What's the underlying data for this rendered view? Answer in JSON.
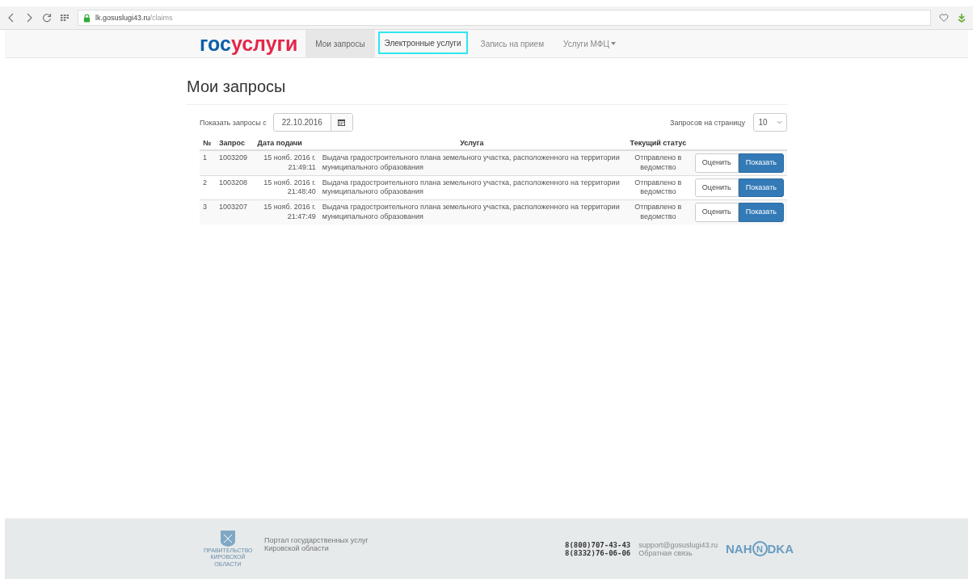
{
  "browser": {
    "url_host": "lk.gosuslugi43.ru",
    "url_path": "/claims"
  },
  "logo": {
    "part_1": "гос",
    "part_2": "услуги"
  },
  "nav": [
    {
      "label": "Мои запросы",
      "selected": true,
      "focused": false,
      "dropdown": false
    },
    {
      "label": "Электронные услуги",
      "selected": false,
      "focused": true,
      "dropdown": false
    },
    {
      "label": "Запись на прием",
      "selected": false,
      "focused": false,
      "dropdown": false
    },
    {
      "label": "Услуги МФЦ",
      "selected": false,
      "focused": false,
      "dropdown": true
    }
  ],
  "page_title": "Мои запросы",
  "filter": {
    "label": "Показать запросы с",
    "date": "22.10.2016",
    "per_page_label": "Запросов на страницу",
    "per_page": "10"
  },
  "table": {
    "columns": [
      "№",
      "Запрос",
      "Дата подачи",
      "Услуга",
      "Текущий статус"
    ],
    "rows": [
      {
        "num": "1",
        "id": "1003209",
        "date": "15 нояб. 2016 г.",
        "time": "21:49:11",
        "service": "Выдача градостроительного плана земельного участка, расположенного на территории муниципального образования",
        "status": "Отправлено в ведомство",
        "rate": "Оценить",
        "show": "Показать"
      },
      {
        "num": "2",
        "id": "1003208",
        "date": "15 нояб. 2016 г.",
        "time": "21:48:40",
        "service": "Выдача градостроительного плана земельного участка, расположенного на территории муниципального образования",
        "status": "Отправлено в ведомство",
        "rate": "Оценить",
        "show": "Показать"
      },
      {
        "num": "3",
        "id": "1003207",
        "date": "15 нояб. 2016 г.",
        "time": "21:47:49",
        "service": "Выдача градостроительного плана земельного участка, расположенного на территории муниципального образования",
        "status": "Отправлено в ведомство",
        "rate": "Оценить",
        "show": "Показать"
      }
    ]
  },
  "footer": {
    "emblem_caption": "ПРАВИТЕЛЬСТВО КИРОВСКОЙ ОБЛАСТИ",
    "portal_lines": [
      "Портал государственных услуг",
      "Кировской области"
    ],
    "phones": [
      "8(800)707-43-43",
      "8(8332)76-06-06"
    ],
    "links": [
      "support@gosuslugi43.ru",
      "Обратная связь"
    ],
    "brand": {
      "left": "NAH",
      "mark": "N",
      "right": "DKA"
    }
  }
}
